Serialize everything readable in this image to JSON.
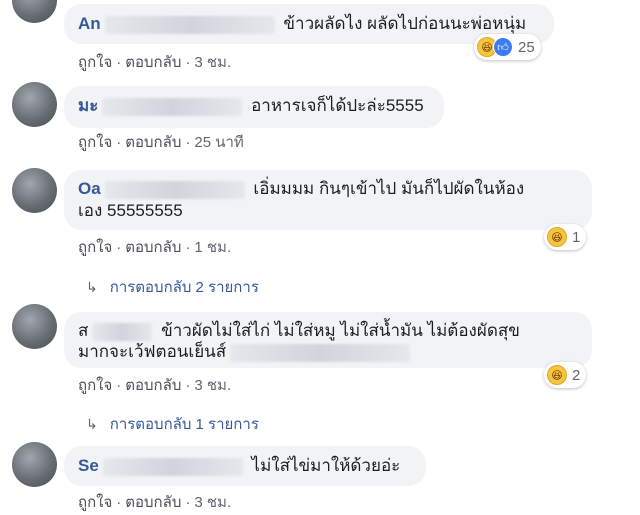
{
  "comments": [
    {
      "name": "An",
      "text": "ข้าวผลัดไง ผลัดไปก่อนนะพ่อหนุ่ม",
      "like_label": "ถูกใจ",
      "reply_label": "ตอบกลับ",
      "time": "3 ชม.",
      "reaction_count": "25"
    },
    {
      "name": "มะ",
      "text": "อาหารเจก็ได้ปะล่ะ5555",
      "like_label": "ถูกใจ",
      "reply_label": "ตอบกลับ",
      "time": "25 นาที"
    },
    {
      "name": "Oa",
      "text_line1": "เอิ่มมมม กินๆเข้าไป มันก็ไปผัดในห้อง",
      "text_line2": "เอง 55555555",
      "like_label": "ถูกใจ",
      "reply_label": "ตอบกลับ",
      "time": "1 ชม.",
      "reaction_count": "1",
      "replies_label": "การตอบกลับ 2 รายการ"
    },
    {
      "name": "ส",
      "text_line1": "ข้าวผัดไม่ใส่ไก่ ไม่ใส่หมู ไม่ใส่น้ำมัน ไม่ต้องผัดสุข",
      "text_line2": "มากจะเว้ฟตอนเย็นส์",
      "like_label": "ถูกใจ",
      "reply_label": "ตอบกลับ",
      "time": "3 ชม.",
      "reaction_count": "2",
      "replies_label": "การตอบกลับ 1 รายการ"
    },
    {
      "name": "Se",
      "text": "ไม่ใส่ไข่มาให้ด้วยอ่ะ",
      "like_label": "ถูกใจ",
      "reply_label": "ตอบกลับ",
      "time": "3 ชม."
    }
  ],
  "icons": {
    "reply_arrow": "reply-arrow-icon",
    "haha": "haha-reaction-icon",
    "like": "like-reaction-icon"
  },
  "colors": {
    "name": "#385898",
    "bubble": "#f2f3f5",
    "meta": "#606770"
  }
}
